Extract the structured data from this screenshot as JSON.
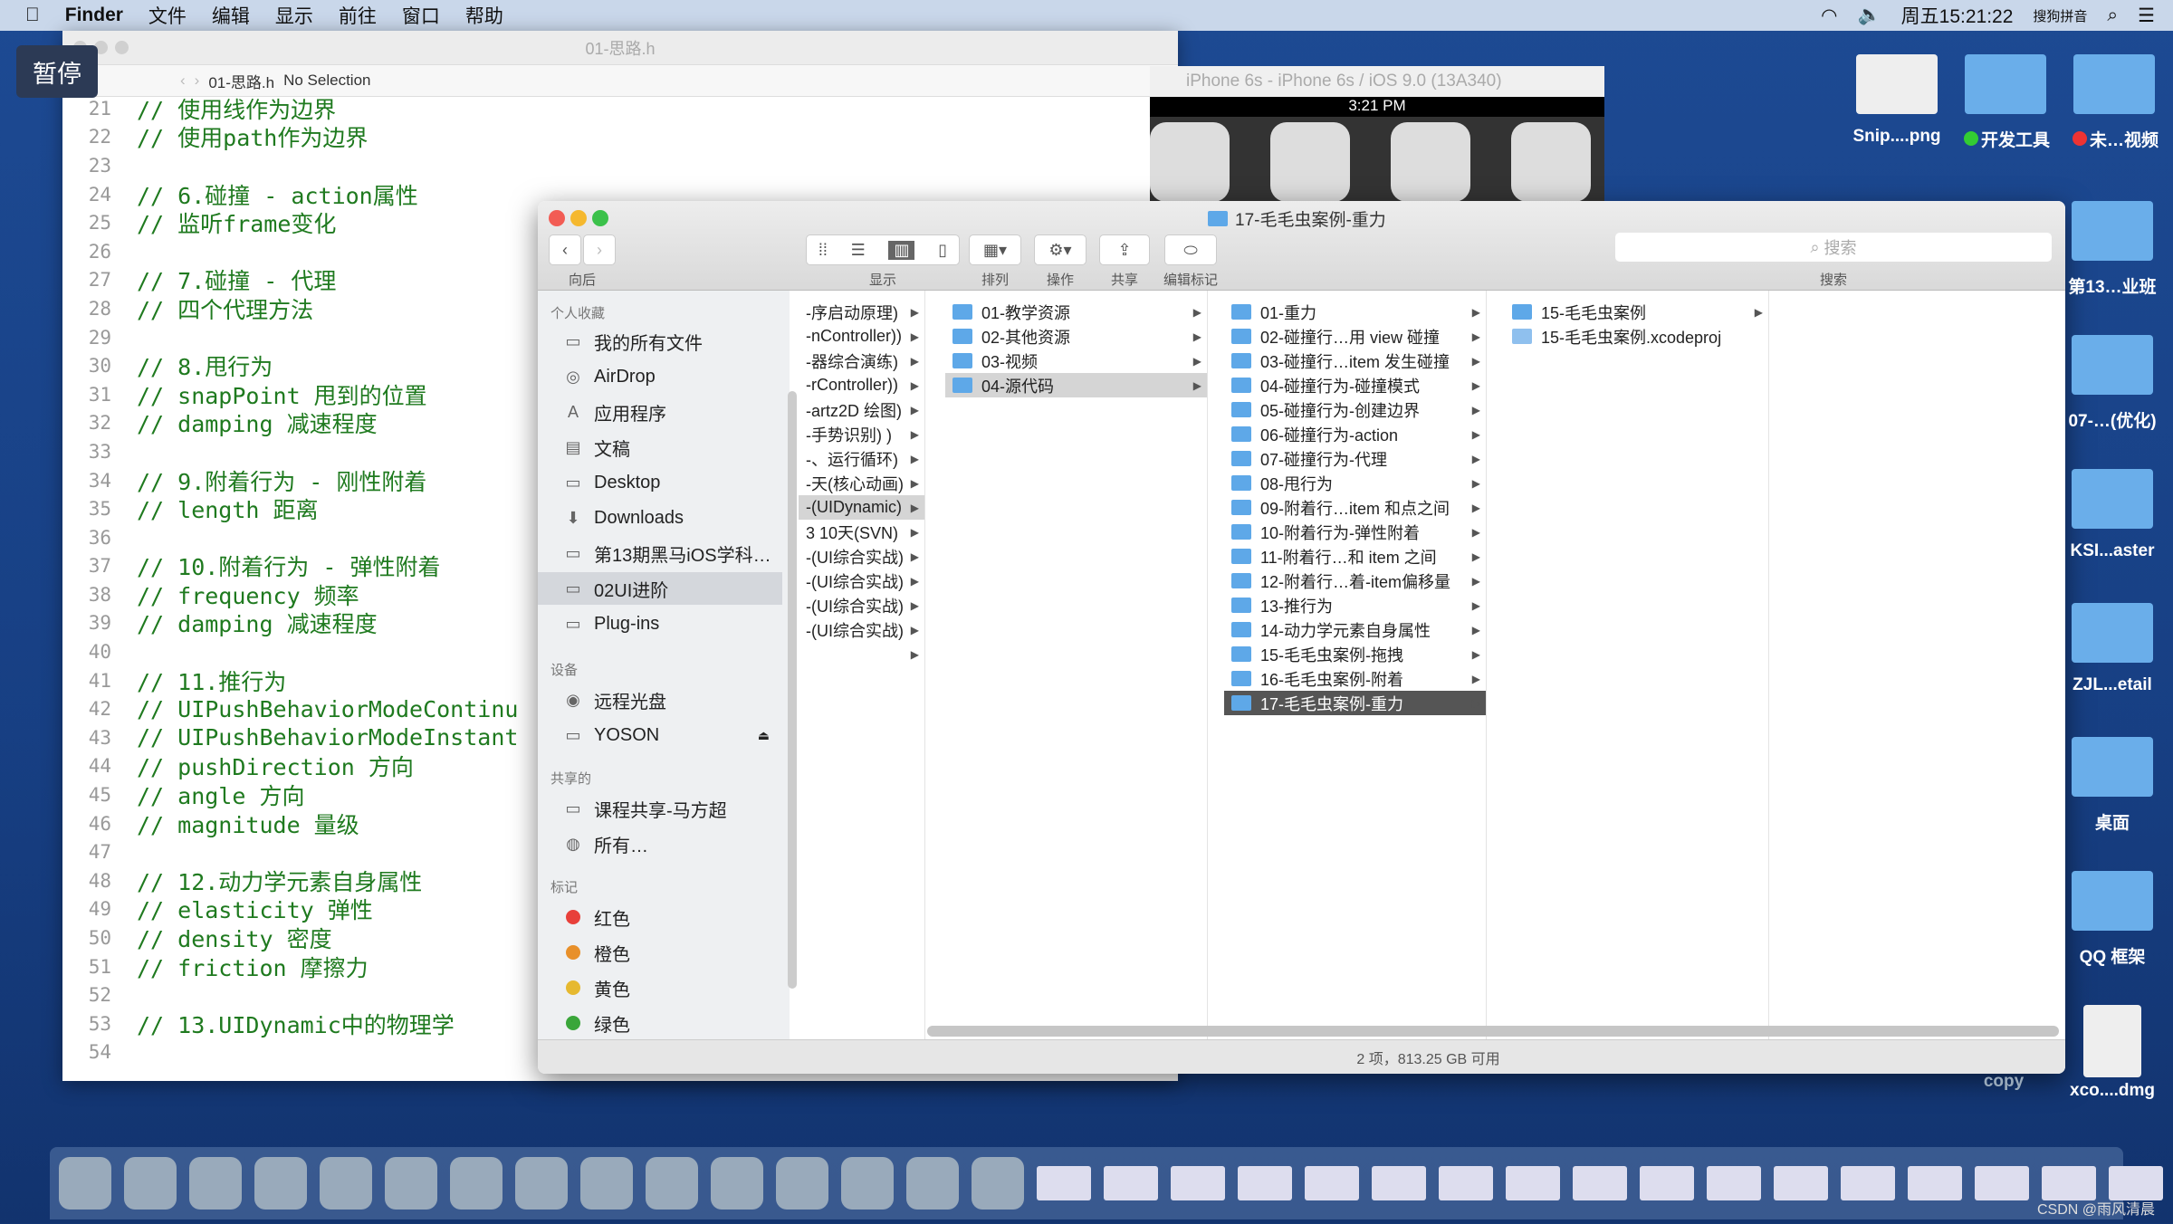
{
  "menubar": {
    "app": "Finder",
    "items": [
      "文件",
      "编辑",
      "显示",
      "前往",
      "窗口",
      "帮助"
    ],
    "clock": "周五15:21:22",
    "ime": "搜狗拼音"
  },
  "pause_badge": "暂停",
  "xcode": {
    "title": "01-思路.h",
    "breadcrumb_file": "01-思路.h",
    "breadcrumb_sel": "No Selection",
    "lines": [
      [
        "21",
        "// 使用线作为边界"
      ],
      [
        "22",
        "// 使用path作为边界"
      ],
      [
        "23",
        ""
      ],
      [
        "24",
        "// 6.碰撞 - action属性"
      ],
      [
        "25",
        "// 监听frame变化"
      ],
      [
        "26",
        ""
      ],
      [
        "27",
        "// 7.碰撞 - 代理"
      ],
      [
        "28",
        "// 四个代理方法"
      ],
      [
        "29",
        ""
      ],
      [
        "30",
        "// 8.甩行为"
      ],
      [
        "31",
        "// snapPoint 甩到的位置"
      ],
      [
        "32",
        "// damping 减速程度"
      ],
      [
        "33",
        ""
      ],
      [
        "34",
        "// 9.附着行为 - 刚性附着"
      ],
      [
        "35",
        "// length 距离"
      ],
      [
        "36",
        ""
      ],
      [
        "37",
        "// 10.附着行为 - 弹性附着"
      ],
      [
        "38",
        "// frequency 频率"
      ],
      [
        "39",
        "// damping 减速程度"
      ],
      [
        "40",
        ""
      ],
      [
        "41",
        "// 11.推行为"
      ],
      [
        "42",
        "// UIPushBehaviorModeContinu"
      ],
      [
        "43",
        "// UIPushBehaviorModeInstant"
      ],
      [
        "44",
        "// pushDirection 方向"
      ],
      [
        "45",
        "// angle 方向"
      ],
      [
        "46",
        "// magnitude 量级"
      ],
      [
        "47",
        ""
      ],
      [
        "48",
        "// 12.动力学元素自身属性"
      ],
      [
        "49",
        "// elasticity 弹性"
      ],
      [
        "50",
        "// density 密度"
      ],
      [
        "51",
        "// friction 摩擦力"
      ],
      [
        "52",
        ""
      ],
      [
        "53",
        "// 13.UIDynamic中的物理学"
      ],
      [
        "54",
        ""
      ]
    ]
  },
  "simulator": {
    "title": "iPhone 6s - iPhone 6s / iOS 9.0 (13A340)",
    "time": "3:21 PM"
  },
  "finder": {
    "title": "17-毛毛虫案例-重力",
    "toolbar": {
      "back": "向后",
      "view": "显示",
      "arrange": "排列",
      "action": "操作",
      "share": "共享",
      "tags": "编辑标记",
      "search_placeholder": "搜索",
      "search_label": "搜索"
    },
    "sidebar": {
      "favorites": "个人收藏",
      "fav_items": [
        "我的所有文件",
        "AirDrop",
        "应用程序",
        "文稿",
        "Desktop",
        "Downloads",
        "第13期黑马iOS学科…",
        "02UI进阶",
        "Plug-ins"
      ],
      "devices": "设备",
      "dev_items": [
        "远程光盘",
        "YOSON"
      ],
      "shared": "共享的",
      "shared_items": [
        "课程共享-马方超",
        "所有…"
      ],
      "tags": "标记",
      "tag_items": [
        {
          "label": "红色",
          "color": "#e8403a"
        },
        {
          "label": "橙色",
          "color": "#e8902a"
        },
        {
          "label": "黄色",
          "color": "#e6b930"
        },
        {
          "label": "绿色",
          "color": "#3aa63a"
        }
      ]
    },
    "col1": [
      "-序启动原理)",
      "-nController))",
      "-器综合演练)",
      "-rController))",
      "-artz2D 绘图)",
      "-手势识别) )",
      "-、运行循环)",
      "-天(核心动画)",
      "-(UIDynamic)",
      "3 10天(SVN)",
      "-(UI综合实战)",
      "-(UI综合实战)",
      "-(UI综合实战)",
      "-(UI综合实战)",
      ""
    ],
    "col2": [
      "01-教学资源",
      "02-其他资源",
      "03-视频",
      "04-源代码"
    ],
    "col3": [
      "01-重力",
      "02-碰撞行…用 view 碰撞",
      "03-碰撞行…item 发生碰撞",
      "04-碰撞行为-碰撞模式",
      "05-碰撞行为-创建边界",
      "06-碰撞行为-action",
      "07-碰撞行为-代理",
      "08-甩行为",
      "09-附着行…item 和点之间",
      "10-附着行为-弹性附着",
      "11-附着行…和 item 之间",
      "12-附着行…着-item偏移量",
      "13-推行为",
      "14-动力学元素自身属性",
      "15-毛毛虫案例-拖拽",
      "16-毛毛虫案例-附着",
      "17-毛毛虫案例-重力"
    ],
    "col4": [
      "15-毛毛虫案例",
      "15-毛毛虫案例.xcodeproj"
    ],
    "status": "2 项，813.25 GB 可用"
  },
  "desktop": {
    "top": [
      "Snip....png",
      "开发工具",
      "未…视频"
    ],
    "right": [
      "第13…业班",
      "07-…(优化)",
      "KSI...aster",
      "ZJL...etail",
      "桌面",
      "QQ 框架",
      "xco....dmg"
    ],
    "bottom": [
      "copy"
    ],
    "watermark": "CSDN @雨风清晨"
  }
}
